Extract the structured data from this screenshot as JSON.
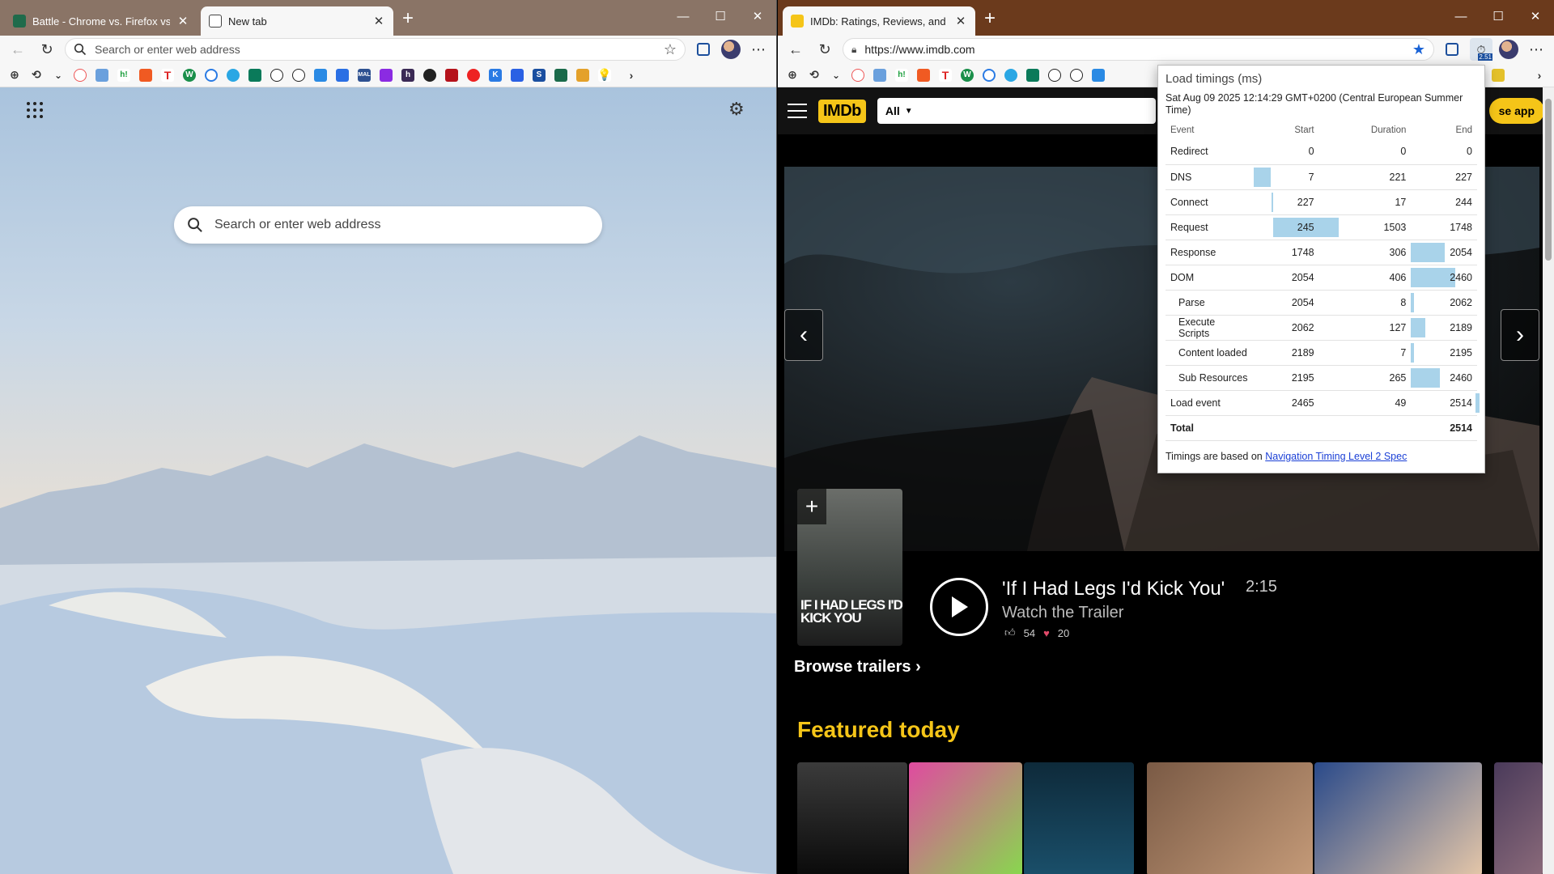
{
  "left": {
    "tabs": [
      {
        "title": "Battle - Chrome vs. Firefox vs. Edge",
        "active": false
      },
      {
        "title": "New tab",
        "active": true
      }
    ],
    "address_placeholder": "Search or enter web address",
    "ntp_search_placeholder": "Search or enter web address"
  },
  "right": {
    "tabs": [
      {
        "title": "IMDb: Ratings, Reviews, and Where to Watch",
        "active": true
      }
    ],
    "url": "https://www.imdb.com",
    "extension_badge": "2.51",
    "imdb": {
      "logo": "IMDb",
      "search_category": "All",
      "use_app": "se app",
      "poster_text": "IF I HAD LEGS I'D KICK YOU",
      "trailer_title": "'If I Had Legs I'd Kick You'",
      "trailer_duration": "2:15",
      "trailer_subtitle": "Watch the Trailer",
      "likes": "54",
      "loves": "20",
      "browse_trailers": "Browse trailers",
      "featured_today": "Featured today"
    }
  },
  "popup": {
    "title": "Load timings (ms)",
    "date": "Sat Aug 09 2025 12:14:29 GMT+0200 (Central European Summer Time)",
    "headers": {
      "event": "Event",
      "start": "Start",
      "duration": "Duration",
      "end": "End"
    },
    "rows": [
      {
        "event": "Redirect",
        "start": "0",
        "duration": "0",
        "end": "0",
        "sub": false,
        "bar_col": "start",
        "bar_from": 0,
        "bar_to": 0
      },
      {
        "event": "DNS",
        "start": "7",
        "duration": "221",
        "end": "227",
        "sub": false,
        "bar_col": "start",
        "bar_from": 7,
        "bar_to": 227
      },
      {
        "event": "Connect",
        "start": "227",
        "duration": "17",
        "end": "244",
        "sub": false,
        "bar_col": "start",
        "bar_from": 227,
        "bar_to": 244
      },
      {
        "event": "Request",
        "start": "245",
        "duration": "1503",
        "end": "1748",
        "sub": false,
        "bar_col": "start",
        "bar_from": 245,
        "bar_to": 1748
      },
      {
        "event": "Response",
        "start": "1748",
        "duration": "306",
        "end": "2054",
        "sub": false,
        "bar_col": "duration",
        "bar_from": 1748,
        "bar_to": 2054
      },
      {
        "event": "DOM",
        "start": "2054",
        "duration": "406",
        "end": "2460",
        "sub": false,
        "bar_col": "duration",
        "bar_from": 2054,
        "bar_to": 2460
      },
      {
        "event": "Parse",
        "start": "2054",
        "duration": "8",
        "end": "2062",
        "sub": true,
        "bar_col": "duration",
        "bar_from": 2054,
        "bar_to": 2062
      },
      {
        "event": "Execute Scripts",
        "start": "2062",
        "duration": "127",
        "end": "2189",
        "sub": true,
        "bar_col": "duration",
        "bar_from": 2062,
        "bar_to": 2189
      },
      {
        "event": "Content loaded",
        "start": "2189",
        "duration": "7",
        "end": "2195",
        "sub": true,
        "bar_col": "duration",
        "bar_from": 2189,
        "bar_to": 2195
      },
      {
        "event": "Sub Resources",
        "start": "2195",
        "duration": "265",
        "end": "2460",
        "sub": true,
        "bar_col": "duration",
        "bar_from": 2195,
        "bar_to": 2460
      },
      {
        "event": "Load event",
        "start": "2465",
        "duration": "49",
        "end": "2514",
        "sub": false,
        "bar_col": "end",
        "bar_from": 2465,
        "bar_to": 2514
      }
    ],
    "total_label": "Total",
    "total_value": "2514",
    "footer_text": "Timings are based on ",
    "footer_link": "Navigation Timing Level 2 Spec"
  },
  "colors": {
    "imdb_yellow": "#f5c518",
    "timing_bar": "#a9d3ea",
    "link": "#1a3fd6"
  }
}
